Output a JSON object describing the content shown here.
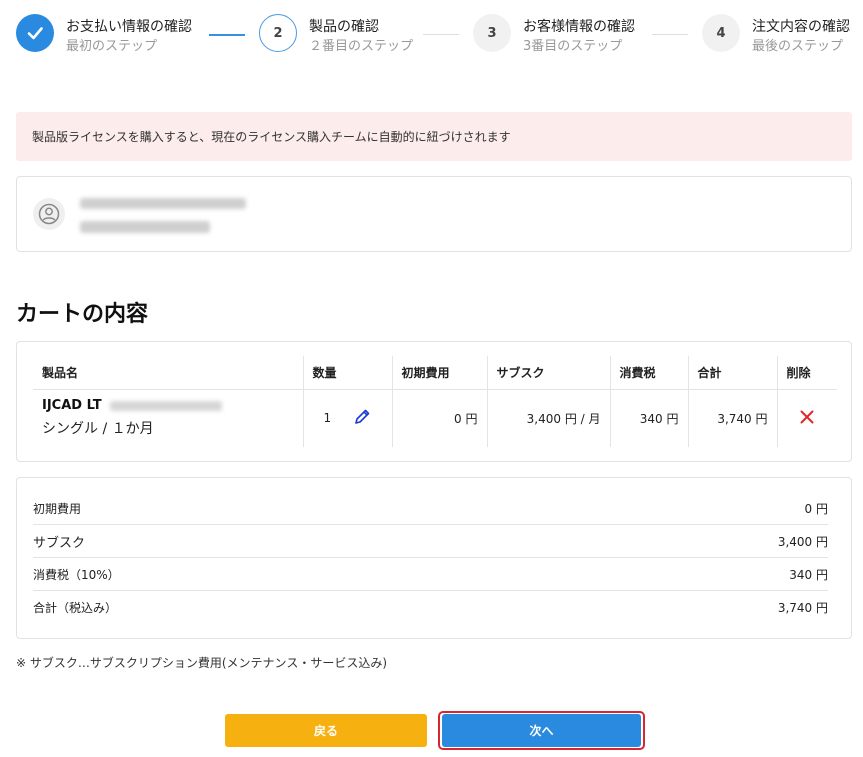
{
  "stepper": {
    "steps": [
      {
        "number": "",
        "title": "お支払い情報の確認",
        "subtitle": "最初のステップ",
        "state": "done"
      },
      {
        "number": "2",
        "title": "製品の確認",
        "subtitle": "２番目のステップ",
        "state": "active"
      },
      {
        "number": "3",
        "title": "お客様情報の確認",
        "subtitle": "3番目のステップ",
        "state": "todo"
      },
      {
        "number": "4",
        "title": "注文内容の確認",
        "subtitle": "最後のステップ",
        "state": "todo"
      }
    ]
  },
  "notice": {
    "text": "製品版ライセンスを購入すると、現在のライセンス購入チームに自動的に紐づけされます"
  },
  "cart": {
    "heading": "カートの内容",
    "columns": [
      "製品名",
      "数量",
      "初期費用",
      "サブスク",
      "消費税",
      "合計",
      "削除"
    ],
    "item": {
      "name": "IJCAD LT",
      "plan": "シングル / １か月",
      "quantity": "1",
      "initial_fee": "0 円",
      "subscription": "3,400 円 / 月",
      "tax": "340 円",
      "total": "3,740 円"
    }
  },
  "summary": {
    "rows": [
      {
        "label": "初期費用",
        "value": "0 円"
      },
      {
        "label": "サブスク",
        "value": "3,400 円"
      },
      {
        "label": "消費税（10%）",
        "value": "340 円"
      },
      {
        "label": "合計（税込み）",
        "value": "3,740 円"
      }
    ]
  },
  "footnote": "※ サブスク…サブスクリプション費用(メンテナンス・サービス込み)",
  "buttons": {
    "back": "戻る",
    "next": "次へ"
  },
  "colors": {
    "primary": "#2a8ae0",
    "warning": "#f6b00f",
    "notice_bg": "#fdecec",
    "delete": "#e0262b",
    "highlight": "#d9262e"
  },
  "icons": [
    "check-icon",
    "user-circle-icon",
    "pencil-icon",
    "close-icon"
  ]
}
